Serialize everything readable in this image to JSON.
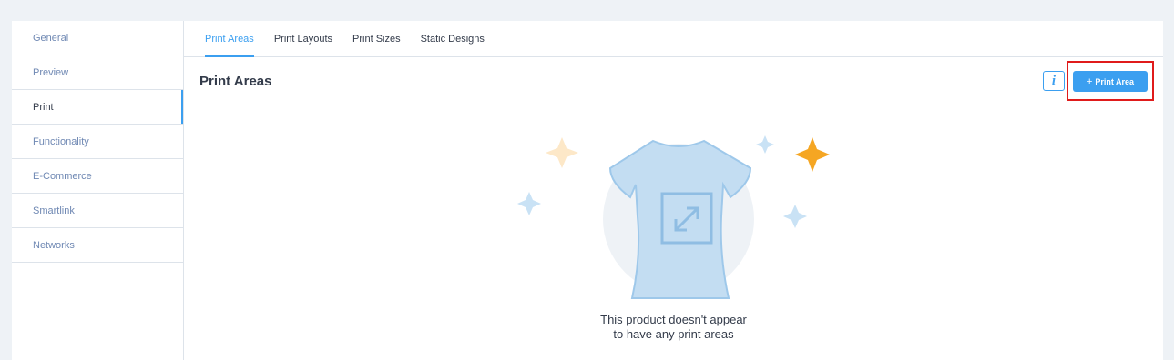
{
  "sidebar": {
    "items": [
      {
        "label": "General"
      },
      {
        "label": "Preview"
      },
      {
        "label": "Print"
      },
      {
        "label": "Functionality"
      },
      {
        "label": "E-Commerce"
      },
      {
        "label": "Smartlink"
      },
      {
        "label": "Networks"
      }
    ],
    "active": "Print"
  },
  "tabs": [
    {
      "label": "Print Areas"
    },
    {
      "label": "Print Layouts"
    },
    {
      "label": "Print Sizes"
    },
    {
      "label": "Static Designs"
    }
  ],
  "active_tab": "Print Areas",
  "page": {
    "title": "Print Areas",
    "info_label": "i",
    "add_button_plus": "+",
    "add_button_label": "Print Area",
    "empty_line1": "This product doesn't appear",
    "empty_line2": "to have any print areas"
  },
  "icons": {
    "info": "info-icon",
    "plus": "plus-icon",
    "illustration": "tshirt-illustration"
  },
  "colors": {
    "accent": "#3b9ff0",
    "highlight": "#e01b1b",
    "sparkle_orange": "#f5a623"
  }
}
